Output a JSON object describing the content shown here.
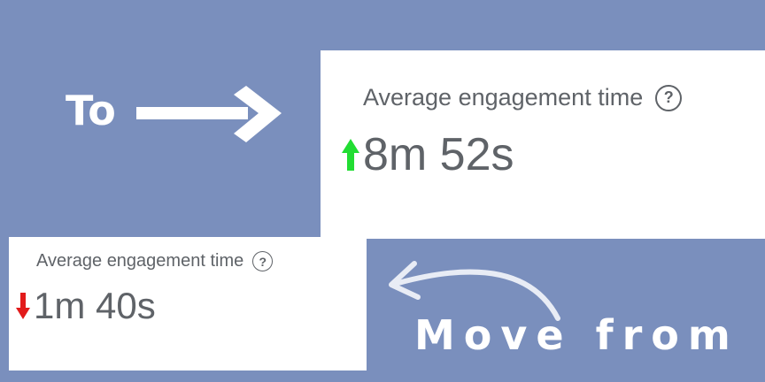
{
  "captions": {
    "to": "To",
    "move_from": "Move from"
  },
  "metric_after": {
    "label": "Average engagement time",
    "value": "8m 52s",
    "trend": "up",
    "trend_color": "#22dd33"
  },
  "metric_before": {
    "label": "Average engagement time",
    "value": "1m 40s",
    "trend": "down",
    "trend_color": "#e21b1b"
  },
  "colors": {
    "background": "#7a8fbd",
    "card": "#ffffff",
    "text": "#5f6368",
    "caption": "#ffffff"
  },
  "icons": {
    "help": "?",
    "right_arrow": "right-arrow-icon",
    "curved_arrow": "curved-arrow-icon"
  }
}
